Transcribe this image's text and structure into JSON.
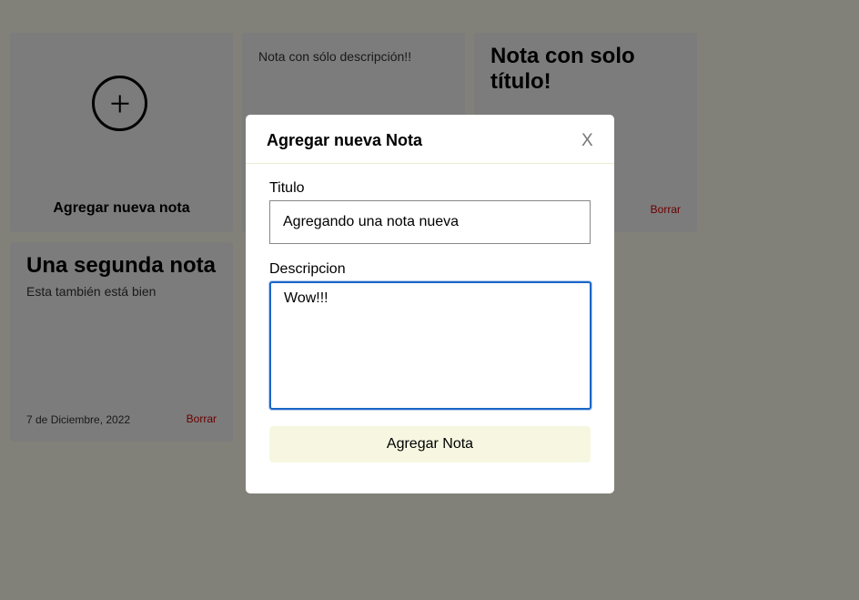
{
  "notes_grid": {
    "add_card": {
      "label": "Agregar nueva nota",
      "icon": "plus-circle-icon"
    },
    "cards": [
      {
        "title": "",
        "description": "Nota con sólo descripción!!",
        "date": "",
        "delete_label": ""
      },
      {
        "title": "Nota con solo título!",
        "description": "",
        "date": "",
        "delete_label": "Borrar"
      },
      {
        "title": "Una segunda nota",
        "description": "Esta también está bien",
        "date": "7 de Diciembre, 2022",
        "delete_label": "Borrar"
      }
    ]
  },
  "modal": {
    "title": "Agregar nueva Nota",
    "close_label": "X",
    "title_field": {
      "label": "Titulo",
      "value": "Agregando una nota nueva"
    },
    "description_field": {
      "label": "Descripcion",
      "value": "Wow!!!"
    },
    "submit_label": "Agregar Nota"
  },
  "colors": {
    "background": "#f7f7e8",
    "card": "#ededee",
    "delete": "#cc0000",
    "focus_border": "#1a66c9",
    "button": "#f7f7e1"
  }
}
